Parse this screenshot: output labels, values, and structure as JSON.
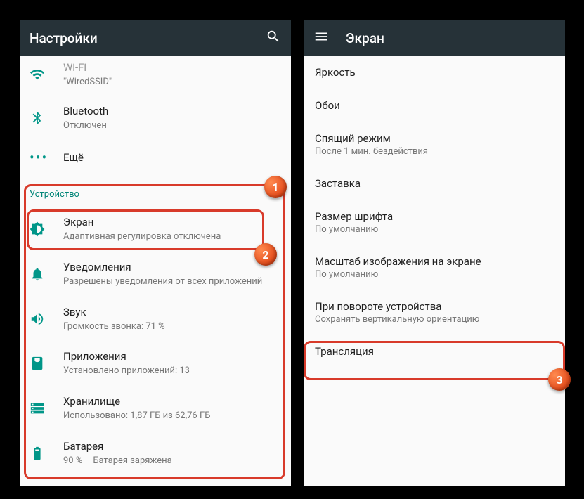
{
  "left": {
    "appbar_title": "Настройки",
    "wifi": {
      "title": "Wi-Fi",
      "sub": "\"WiredSSID\""
    },
    "bt": {
      "title": "Bluetooth",
      "sub": "Отключен"
    },
    "more": {
      "title": "Ещё"
    },
    "section_device": "Устройство",
    "display": {
      "title": "Экран",
      "sub": "Адаптивная регулировка отключена"
    },
    "notif": {
      "title": "Уведомления",
      "sub": "Разрешены уведомления от всех приложений"
    },
    "sound": {
      "title": "Звук",
      "sub": "Громкость звонка: 71 %"
    },
    "apps": {
      "title": "Приложения",
      "sub": "Установлено приложений: 13"
    },
    "storage": {
      "title": "Хранилище",
      "sub": "Использовано: 1,87 ГБ из 62,76 ГБ"
    },
    "battery": {
      "title": "Батарея",
      "sub": "90 % – Батарея заряжена"
    }
  },
  "right": {
    "appbar_title": "Экран",
    "brightness": {
      "title": "Яркость"
    },
    "wallpaper": {
      "title": "Обои"
    },
    "sleep": {
      "title": "Спящий режим",
      "sub": "После 1 мин. бездействия"
    },
    "daydream": {
      "title": "Заставка"
    },
    "fontsize": {
      "title": "Размер шрифта",
      "sub": "По умолчанию"
    },
    "displaysize": {
      "title": "Масштаб изображения на экране",
      "sub": "По умолчанию"
    },
    "rotate": {
      "title": "При повороте устройства",
      "sub": "Сохранять вертикальную ориентацию"
    },
    "cast": {
      "title": "Трансляция"
    }
  },
  "badges": {
    "one": "1",
    "two": "2",
    "three": "3"
  }
}
